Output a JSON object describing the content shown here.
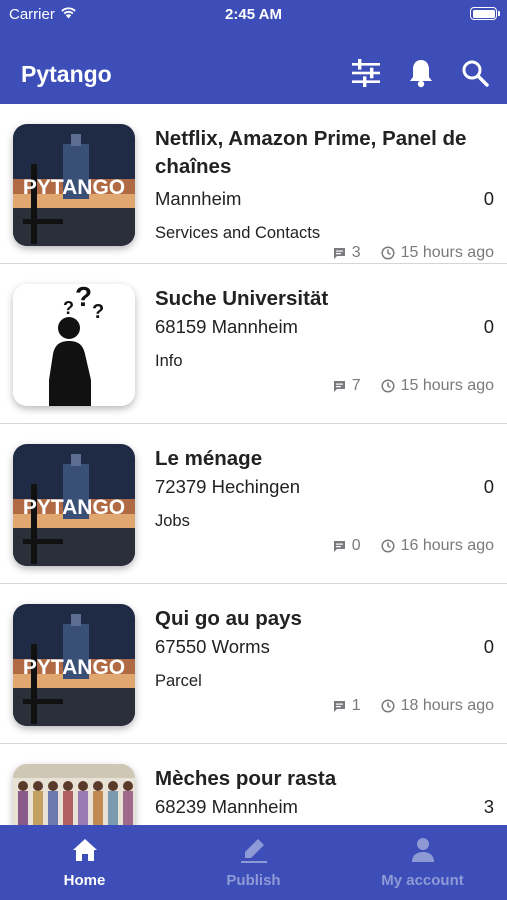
{
  "status_bar": {
    "carrier": "Carrier",
    "time": "2:45 AM"
  },
  "header": {
    "title": "Pytango"
  },
  "thumb_text": "PYTANGO",
  "listings": [
    {
      "title": "Netflix, Amazon Prime, Panel de chaînes",
      "location": "Mannheim",
      "count": "0",
      "category": "Services and Contacts",
      "comments": "3",
      "time_ago": "15 hours ago",
      "thumb": "pytango-logo"
    },
    {
      "title": "Suche Universität",
      "location": "68159 Mannheim",
      "count": "0",
      "category": "Info",
      "comments": "7",
      "time_ago": "15 hours ago",
      "thumb": "question-silhouette"
    },
    {
      "title": "Le ménage",
      "location": "72379 Hechingen",
      "count": "0",
      "category": "Jobs",
      "comments": "0",
      "time_ago": "16 hours ago",
      "thumb": "pytango-logo"
    },
    {
      "title": "Qui go au pays",
      "location": "67550 Worms",
      "count": "0",
      "category": "Parcel",
      "comments": "1",
      "time_ago": "18 hours ago",
      "thumb": "pytango-logo"
    },
    {
      "title": "Mèches pour rasta",
      "location": "68239 Mannheim",
      "count": "3",
      "category": "",
      "comments": "",
      "time_ago": "",
      "thumb": "group-photo"
    }
  ],
  "tabbar": {
    "home": "Home",
    "publish": "Publish",
    "account": "My account"
  },
  "colors": {
    "brand": "#3d4eb8",
    "inactive_tab": "#8e9ad6",
    "meta_gray": "#7a7a7e"
  }
}
